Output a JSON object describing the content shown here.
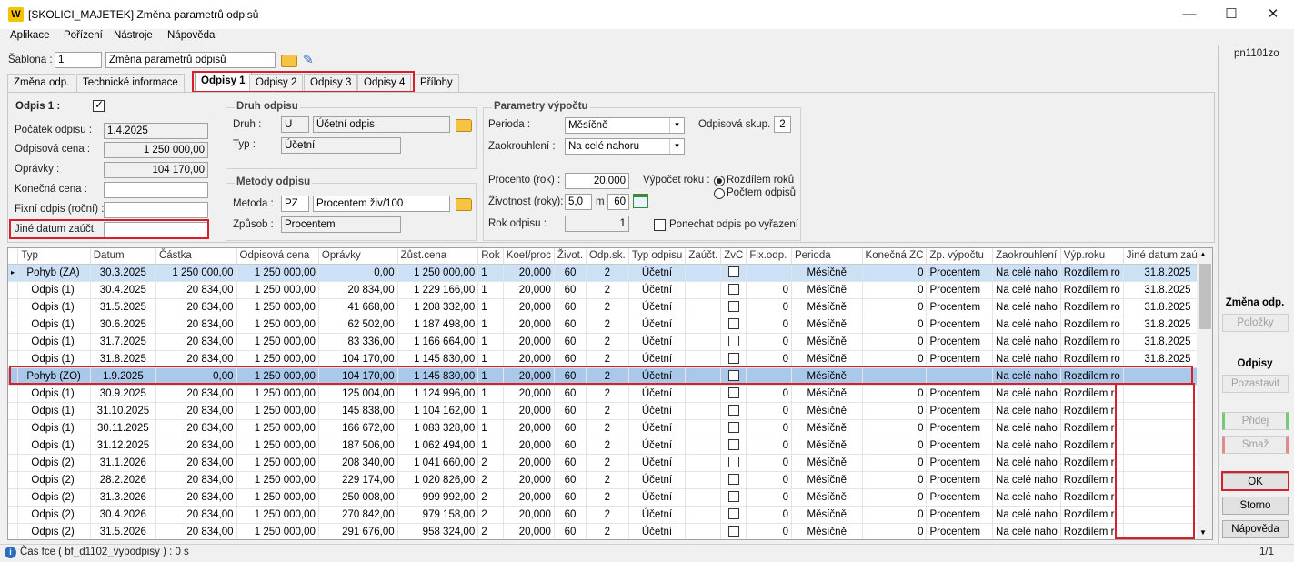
{
  "window": {
    "title": "[SKOLICI_MAJETEK] Změna parametrů odpisů",
    "minimize": "—",
    "maximize": "☐",
    "close": "✕",
    "app_icon": "W"
  },
  "menu": [
    "Aplikace",
    "Pořízení",
    "Nástroje",
    "Nápověda"
  ],
  "template": {
    "label": "Šablona :",
    "number": "1",
    "name": "Změna parametrů odpisů"
  },
  "form_code": "pn1101zo",
  "tabs": [
    "Změna odp.",
    "Technické informace",
    "Odpisy 1",
    "Odpisy 2",
    "Odpisy 3",
    "Odpisy 4",
    "Přílohy"
  ],
  "odpis": {
    "title": "Odpis 1 :",
    "pocatek_label": "Počátek odpisu :",
    "pocatek": "1.4.2025",
    "cena_label": "Odpisová cena :",
    "cena": "1 250 000,00",
    "opravky_label": "Oprávky :",
    "opravky": "104 170,00",
    "konecna_label": "Konečná cena :",
    "konecna": "",
    "fixni_label": "Fixní odpis (roční) :",
    "fixni": "",
    "jine_label": "Jiné datum zaúčt.",
    "jine": ""
  },
  "druh": {
    "title": "Druh odpisu",
    "druh_label": "Druh :",
    "druh_code": "U",
    "druh_name": "Účetní odpis",
    "typ_label": "Typ :",
    "typ": "Účetní"
  },
  "metody": {
    "title": "Metody odpisu",
    "metoda_label": "Metoda :",
    "metoda_code": "PZ",
    "metoda_name": "Procentem živ/100",
    "zpusob_label": "Způsob :",
    "zpusob": "Procentem"
  },
  "params": {
    "title": "Parametry výpočtu",
    "perioda_label": "Perioda :",
    "perioda": "Měsíčně",
    "skup_label": "Odpisová skup. :",
    "skup": "2",
    "zaokr_label": "Zaokrouhlení :",
    "zaokr": "Na celé nahoru",
    "procento_label": "Procento (rok) :",
    "procento": "20,000",
    "vypocet_label": "Výpočet roku :",
    "radio1": "Rozdílem roků",
    "radio2": "Počtem odpisů",
    "zivotnost_label": "Životnost (roky):",
    "zivotnost": "5,0",
    "m_label": "m",
    "mesice": "60",
    "rok_label": "Rok odpisu :",
    "rok": "1",
    "ponechat_label": "Ponechat odpis po vyřazení"
  },
  "grid": {
    "columns": [
      "Typ",
      "Datum",
      "Částka",
      "Odpisová cena",
      "Oprávky",
      "Zůst.cena",
      "Rok",
      "Koef/proc",
      "Život.",
      "Odp.sk.",
      "Typ odpisu",
      "Zaúčt.",
      "ZvC",
      "Fix.odp.",
      "Perioda",
      "Konečná ZC",
      "Zp. výpočtu",
      "Zaokrouhlení",
      "Výp.roku",
      "Jiné datum zaúčt."
    ],
    "rows": [
      [
        "Pohyb (ZA)",
        "30.3.2025",
        "1 250 000,00",
        "1 250 000,00",
        "0,00",
        "1 250 000,00",
        "1",
        "20,000",
        "60",
        "2",
        "Účetní",
        "",
        "",
        "",
        "Měsíčně",
        "0",
        "Procentem",
        "Na celé naho",
        "Rozdílem ro",
        "31.8.2025"
      ],
      [
        "Odpis (1)",
        "30.4.2025",
        "20 834,00",
        "1 250 000,00",
        "20 834,00",
        "1 229 166,00",
        "1",
        "20,000",
        "60",
        "2",
        "Účetní",
        "",
        "",
        "0",
        "Měsíčně",
        "0",
        "Procentem",
        "Na celé naho",
        "Rozdílem ro",
        "31.8.2025"
      ],
      [
        "Odpis (1)",
        "31.5.2025",
        "20 834,00",
        "1 250 000,00",
        "41 668,00",
        "1 208 332,00",
        "1",
        "20,000",
        "60",
        "2",
        "Účetní",
        "",
        "",
        "0",
        "Měsíčně",
        "0",
        "Procentem",
        "Na celé naho",
        "Rozdílem ro",
        "31.8.2025"
      ],
      [
        "Odpis (1)",
        "30.6.2025",
        "20 834,00",
        "1 250 000,00",
        "62 502,00",
        "1 187 498,00",
        "1",
        "20,000",
        "60",
        "2",
        "Účetní",
        "",
        "",
        "0",
        "Měsíčně",
        "0",
        "Procentem",
        "Na celé naho",
        "Rozdílem ro",
        "31.8.2025"
      ],
      [
        "Odpis (1)",
        "31.7.2025",
        "20 834,00",
        "1 250 000,00",
        "83 336,00",
        "1 166 664,00",
        "1",
        "20,000",
        "60",
        "2",
        "Účetní",
        "",
        "",
        "0",
        "Měsíčně",
        "0",
        "Procentem",
        "Na celé naho",
        "Rozdílem ro",
        "31.8.2025"
      ],
      [
        "Odpis (1)",
        "31.8.2025",
        "20 834,00",
        "1 250 000,00",
        "104 170,00",
        "1 145 830,00",
        "1",
        "20,000",
        "60",
        "2",
        "Účetní",
        "",
        "",
        "0",
        "Měsíčně",
        "0",
        "Procentem",
        "Na celé naho",
        "Rozdílem ro",
        "31.8.2025"
      ],
      [
        "Pohyb (ZO)",
        "1.9.2025",
        "0,00",
        "1 250 000,00",
        "104 170,00",
        "1 145 830,00",
        "1",
        "20,000",
        "60",
        "2",
        "Účetní",
        "",
        "",
        "",
        "Měsíčně",
        "",
        "",
        "Na celé naho",
        "Rozdílem ro",
        ""
      ],
      [
        "Odpis (1)",
        "30.9.2025",
        "20 834,00",
        "1 250 000,00",
        "125 004,00",
        "1 124 996,00",
        "1",
        "20,000",
        "60",
        "2",
        "Účetní",
        "",
        "",
        "0",
        "Měsíčně",
        "0",
        "Procentem",
        "Na celé naho",
        "Rozdílem r",
        ""
      ],
      [
        "Odpis (1)",
        "31.10.2025",
        "20 834,00",
        "1 250 000,00",
        "145 838,00",
        "1 104 162,00",
        "1",
        "20,000",
        "60",
        "2",
        "Účetní",
        "",
        "",
        "0",
        "Měsíčně",
        "0",
        "Procentem",
        "Na celé naho",
        "Rozdílem r",
        ""
      ],
      [
        "Odpis (1)",
        "30.11.2025",
        "20 834,00",
        "1 250 000,00",
        "166 672,00",
        "1 083 328,00",
        "1",
        "20,000",
        "60",
        "2",
        "Účetní",
        "",
        "",
        "0",
        "Měsíčně",
        "0",
        "Procentem",
        "Na celé naho",
        "Rozdílem r",
        ""
      ],
      [
        "Odpis (1)",
        "31.12.2025",
        "20 834,00",
        "1 250 000,00",
        "187 506,00",
        "1 062 494,00",
        "1",
        "20,000",
        "60",
        "2",
        "Účetní",
        "",
        "",
        "0",
        "Měsíčně",
        "0",
        "Procentem",
        "Na celé naho",
        "Rozdílem r",
        ""
      ],
      [
        "Odpis (2)",
        "31.1.2026",
        "20 834,00",
        "1 250 000,00",
        "208 340,00",
        "1 041 660,00",
        "2",
        "20,000",
        "60",
        "2",
        "Účetní",
        "",
        "",
        "0",
        "Měsíčně",
        "0",
        "Procentem",
        "Na celé naho",
        "Rozdílem r",
        ""
      ],
      [
        "Odpis (2)",
        "28.2.2026",
        "20 834,00",
        "1 250 000,00",
        "229 174,00",
        "1 020 826,00",
        "2",
        "20,000",
        "60",
        "2",
        "Účetní",
        "",
        "",
        "0",
        "Měsíčně",
        "0",
        "Procentem",
        "Na celé naho",
        "Rozdílem r",
        ""
      ],
      [
        "Odpis (2)",
        "31.3.2026",
        "20 834,00",
        "1 250 000,00",
        "250 008,00",
        "999 992,00",
        "2",
        "20,000",
        "60",
        "2",
        "Účetní",
        "",
        "",
        "0",
        "Měsíčně",
        "0",
        "Procentem",
        "Na celé naho",
        "Rozdílem r",
        ""
      ],
      [
        "Odpis (2)",
        "30.4.2026",
        "20 834,00",
        "1 250 000,00",
        "270 842,00",
        "979 158,00",
        "2",
        "20,000",
        "60",
        "2",
        "Účetní",
        "",
        "",
        "0",
        "Měsíčně",
        "0",
        "Procentem",
        "Na celé naho",
        "Rozdílem r",
        ""
      ],
      [
        "Odpis (2)",
        "31.5.2026",
        "20 834,00",
        "1 250 000,00",
        "291 676,00",
        "958 324,00",
        "2",
        "20,000",
        "60",
        "2",
        "Účetní",
        "",
        "",
        "0",
        "Měsíčně",
        "0",
        "Procentem",
        "Na celé naho",
        "Rozdílem r",
        ""
      ]
    ]
  },
  "side": {
    "zmena_title": "Změna odp.",
    "polozky": "Položky",
    "odpisy_title": "Odpisy",
    "pozastavit": "Pozastavit",
    "pridej": "Přidej",
    "smaz": "Smaž",
    "ok": "OK",
    "storno": "Storno",
    "napoveda": "Nápověda"
  },
  "status": {
    "text": "Čas fce ( bf_d1102_vypodpisy ) : 0 s",
    "page": "1/1",
    "info_icon": "i"
  }
}
